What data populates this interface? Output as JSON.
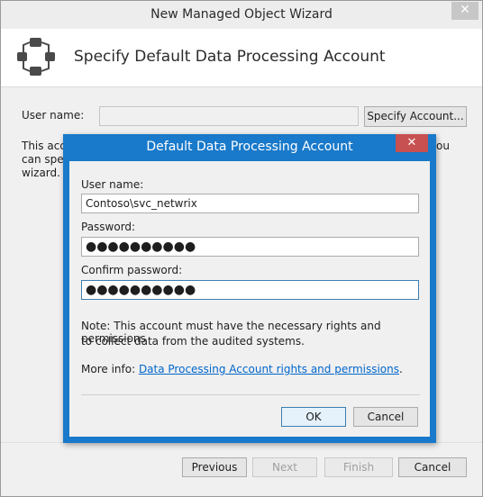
{
  "window": {
    "title": "New Managed Object Wizard",
    "close_glyph": "✕"
  },
  "header": {
    "title": "Specify Default Data Processing Account",
    "icon": "network-nodes-icon"
  },
  "form": {
    "username_label": "User name:",
    "username_value": "",
    "specify_button": "Specify Account...",
    "description_left": "This accou",
    "description_left2": "can spec",
    "description_left3": "wizard.",
    "description_right": "ou"
  },
  "footer": {
    "previous": "Previous",
    "next": "Next",
    "finish": "Finish",
    "cancel": "Cancel"
  },
  "dialog": {
    "title": "Default Data Processing Account",
    "close_glyph": "✕",
    "username_label": "User name:",
    "username_value": "Contoso\\svc_netwrix",
    "password_label": "Password:",
    "password_value": "●●●●●●●●●●",
    "confirm_label": "Confirm password:",
    "confirm_value": "●●●●●●●●●●",
    "note_line1": "Note: This account must have the necessary rights and permissions",
    "note_line2": "to collect data from the audited systems.",
    "more_info_label": "More info: ",
    "more_info_link": "Data Processing Account rights and permissions",
    "more_info_period": ".",
    "ok": "OK",
    "cancel": "Cancel"
  },
  "colors": {
    "dialog_frame": "#1979ca",
    "close_red": "#c75050",
    "link": "#0066cc"
  }
}
